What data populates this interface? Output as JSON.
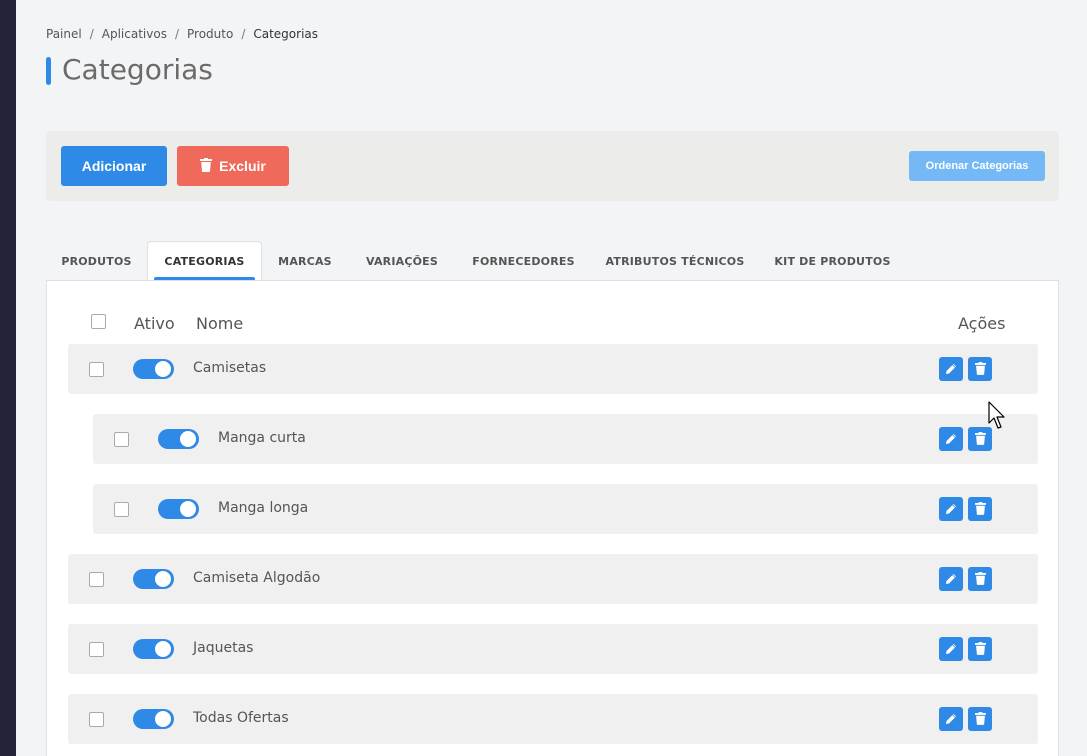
{
  "breadcrumb": [
    "Painel",
    "Aplicativos",
    "Produto",
    "Categorias"
  ],
  "page": {
    "title": "Categorias"
  },
  "toolbar": {
    "add_label": "Adicionar",
    "delete_label": "Excluir",
    "order_label": "Ordenar Categorias"
  },
  "tabs": [
    {
      "label": "PRODUTOS"
    },
    {
      "label": "CATEGORIAS",
      "active": true
    },
    {
      "label": "MARCAS"
    },
    {
      "label": "VARIAÇÕES"
    },
    {
      "label": "FORNECEDORES"
    },
    {
      "label": "ATRIBUTOS TÉCNICOS"
    },
    {
      "label": "KIT DE PRODUTOS"
    }
  ],
  "table": {
    "headers": {
      "active": "Ativo",
      "name": "Nome",
      "actions": "Ações"
    },
    "rows": [
      {
        "name": "Camisetas",
        "active": true,
        "level": 0
      },
      {
        "name": "Manga curta",
        "active": true,
        "level": 1
      },
      {
        "name": "Manga longa",
        "active": true,
        "level": 1
      },
      {
        "name": "Camiseta Algodão",
        "active": true,
        "level": 0
      },
      {
        "name": "Jaquetas",
        "active": true,
        "level": 0
      },
      {
        "name": "Todas Ofertas",
        "active": true,
        "level": 0
      }
    ]
  },
  "colors": {
    "primary": "#2e8ae6",
    "danger": "#ef6a5b",
    "primary_light": "#74b9f5",
    "sidebar": "#23233a"
  },
  "icons": {
    "delete_button": "trash-icon",
    "row_edit": "pencil-icon",
    "row_delete": "trash-icon"
  }
}
